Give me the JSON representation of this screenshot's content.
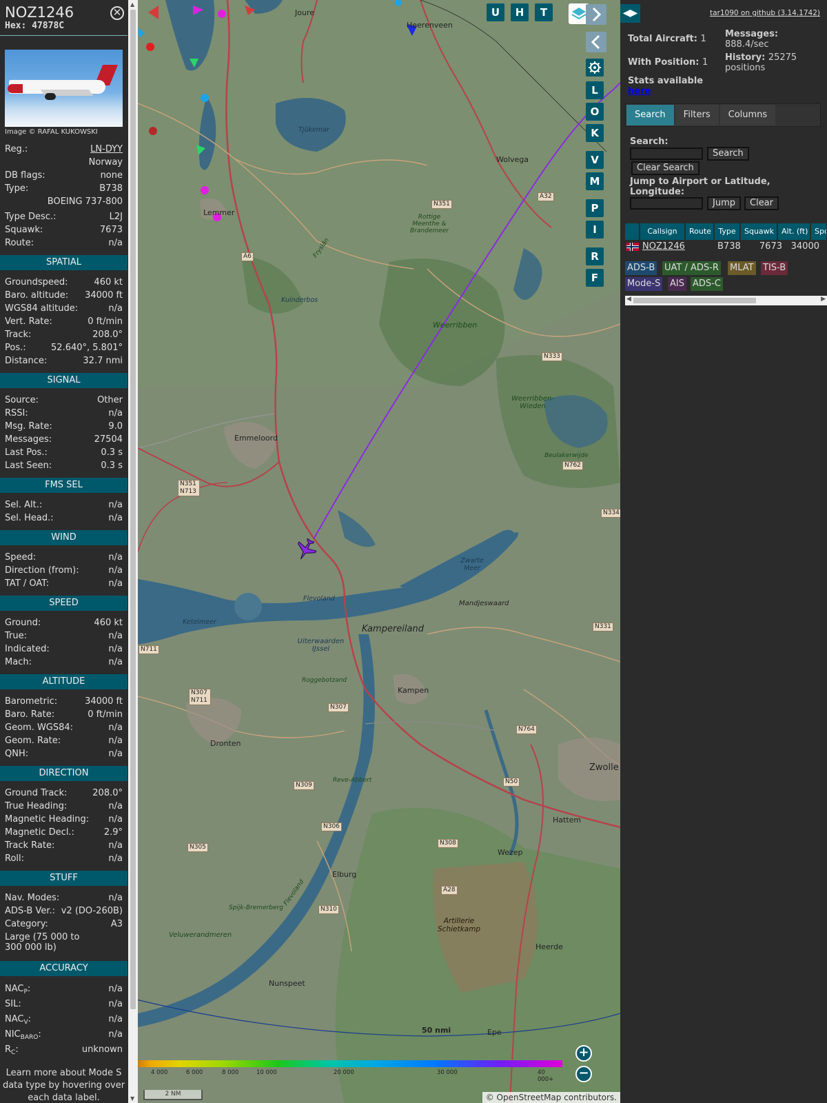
{
  "aircraft": {
    "callsign": "NOZ1246",
    "hex_label": "Hex:",
    "hex": "47878C",
    "image_credit": "Image © RAFAL KUKOWSKI",
    "details": {
      "reg_label": "Reg.:",
      "reg": "LN-DYY",
      "country": "Norway",
      "dbflags_label": "DB flags:",
      "dbflags": "none",
      "type_label": "Type:",
      "type": "B738",
      "type_full": "BOEING 737-800",
      "typedesc_label": "Type Desc.:",
      "typedesc": "L2J",
      "squawk_label": "Squawk:",
      "squawk": "7673",
      "route_label": "Route:",
      "route": "n/a"
    },
    "spatial": {
      "title": "SPATIAL",
      "rows": [
        {
          "label": "Groundspeed:",
          "value": "460 kt"
        },
        {
          "label": "Baro. altitude:",
          "value": "34000 ft"
        },
        {
          "label": "WGS84 altitude:",
          "value": "n/a"
        },
        {
          "label": "Vert. Rate:",
          "value": "0 ft/min"
        },
        {
          "label": "Track:",
          "value": "208.0°"
        },
        {
          "label": "Pos.:",
          "value": "52.640°, 5.801°"
        },
        {
          "label": "Distance:",
          "value": "32.7 nmi"
        }
      ]
    },
    "signal": {
      "title": "SIGNAL",
      "rows": [
        {
          "label": "Source:",
          "value": "Other"
        },
        {
          "label": "RSSI:",
          "value": "n/a"
        },
        {
          "label": "Msg. Rate:",
          "value": "9.0"
        },
        {
          "label": "Messages:",
          "value": "27504"
        },
        {
          "label": "Last Pos.:",
          "value": "0.3 s"
        },
        {
          "label": "Last Seen:",
          "value": "0.3 s"
        }
      ]
    },
    "fms": {
      "title": "FMS SEL",
      "rows": [
        {
          "label": "Sel. Alt.:",
          "value": "n/a"
        },
        {
          "label": "Sel. Head.:",
          "value": "n/a"
        }
      ]
    },
    "wind": {
      "title": "WIND",
      "rows": [
        {
          "label": "Speed:",
          "value": "n/a"
        },
        {
          "label": "Direction (from):",
          "value": "n/a"
        },
        {
          "label": "TAT / OAT:",
          "value": "n/a"
        }
      ]
    },
    "speed": {
      "title": "SPEED",
      "rows": [
        {
          "label": "Ground:",
          "value": "460 kt"
        },
        {
          "label": "True:",
          "value": "n/a"
        },
        {
          "label": "Indicated:",
          "value": "n/a"
        },
        {
          "label": "Mach:",
          "value": "n/a"
        }
      ]
    },
    "altitude": {
      "title": "ALTITUDE",
      "rows": [
        {
          "label": "Barometric:",
          "value": "34000 ft"
        },
        {
          "label": "Baro. Rate:",
          "value": "0 ft/min"
        },
        {
          "label": "Geom. WGS84:",
          "value": "n/a"
        },
        {
          "label": "Geom. Rate:",
          "value": "n/a"
        },
        {
          "label": "QNH:",
          "value": "n/a"
        }
      ]
    },
    "direction": {
      "title": "DIRECTION",
      "rows": [
        {
          "label": "Ground Track:",
          "value": "208.0°"
        },
        {
          "label": "True Heading:",
          "value": "n/a"
        },
        {
          "label": "Magnetic Heading:",
          "value": "n/a"
        },
        {
          "label": "Magnetic Decl.:",
          "value": "2.9°"
        },
        {
          "label": "Track Rate:",
          "value": "n/a"
        },
        {
          "label": "Roll:",
          "value": "n/a"
        }
      ]
    },
    "stuff": {
      "title": "STUFF",
      "rows": [
        {
          "label": "Nav. Modes:",
          "value": "n/a"
        },
        {
          "label": "ADS-B Ver.:",
          "value": "v2 (DO-260B)"
        },
        {
          "label": "Category:",
          "value": "A3"
        }
      ],
      "category_desc": "Large (75 000 to 300 000 lb)"
    },
    "accuracy": {
      "title": "ACCURACY",
      "nacp_main": "NAC",
      "nacp_sub": "P",
      "nacp": "n/a",
      "sil_label": "SIL:",
      "sil": "n/a",
      "nacv_main": "NAC",
      "nacv_sub": "V",
      "nacv": "n/a",
      "nicbaro_main": "NIC",
      "nicbaro_sub": "BARO",
      "nicbaro": "n/a",
      "rc_main": "R",
      "rc_sub": "C",
      "rc": "unknown"
    },
    "footnote": "Learn more about Mode S data type by hovering over each data label."
  },
  "map": {
    "buttons": [
      "U",
      "H",
      "T"
    ],
    "side_buttons": [
      "L",
      "O",
      "K",
      "V",
      "M",
      "P",
      "I",
      "R",
      "F"
    ],
    "places": [
      {
        "name": "Joure"
      },
      {
        "name": "Heerenveen"
      },
      {
        "name": "Wolvega"
      },
      {
        "name": "Lemmer"
      },
      {
        "name": "Emmeloord"
      },
      {
        "name": "Kampereiland"
      },
      {
        "name": "Kampen"
      },
      {
        "name": "Dronten"
      },
      {
        "name": "Zwolle"
      },
      {
        "name": "Hattem"
      },
      {
        "name": "Wezep"
      },
      {
        "name": "Elburg"
      },
      {
        "name": "Nunspeet"
      },
      {
        "name": "Heerde"
      },
      {
        "name": "Epe"
      },
      {
        "name": "Mandjeswaard"
      }
    ],
    "water_labels": [
      "Tjûkemar",
      "Ketelmeer",
      "Zwarte Meer",
      "Flevoland",
      "Kuinderbos",
      "Uiterwaarden IJssel"
    ],
    "green_labels": [
      "Weerribben",
      "Weerribben-Wieden",
      "Rottige Meenthe & Brandemeer",
      "Beulakerwijde",
      "Roggebotzand",
      "Reve-Abbert",
      "Spijk-Bremerberg",
      "Veluwerandmeren",
      "Artillerie Schietkamp",
      "Fryslân",
      "Flevoland"
    ],
    "roads": [
      "N351",
      "A6",
      "N333",
      "A32",
      "N762",
      "N334",
      "N351 N713",
      "N331",
      "N711",
      "N307 N711",
      "N307",
      "N764",
      "N309",
      "N50",
      "N306",
      "N308",
      "N305",
      "A28",
      "N310"
    ],
    "range_label": "50 nmi",
    "color_scale_ticks": [
      "4 000",
      "6 000",
      "8 000",
      "10 000",
      "20 000",
      "30 000",
      "40 000+"
    ],
    "scale_label": "2 NM",
    "attribution": "© OpenStreetMap contributors.",
    "track_color": "#8a2be2"
  },
  "sidebar": {
    "github_link": "tar1090 on github (3.14.1742)",
    "total_aircraft_label": "Total Aircraft:",
    "total_aircraft": "1",
    "with_position_label": "With Position:",
    "with_position": "1",
    "messages_label": "Messages:",
    "messages": "888.4/sec",
    "history_label": "History:",
    "history": "25275 positions",
    "stats_label": "Stats available",
    "stats_link": "here",
    "tabs": [
      "Search",
      "Filters",
      "Columns"
    ],
    "search_label": "Search:",
    "search_button": "Search",
    "clear_search_button": "Clear Search",
    "jump_label": "Jump to Airport or Latitude, Longitude:",
    "jump_button": "Jump",
    "clear_button": "Clear",
    "table_headers": [
      "Callsign",
      "Route",
      "Type",
      "Squawk",
      "Alt. (ft)",
      "Spd"
    ],
    "table_row": {
      "callsign": "NOZ1246",
      "type": "B738",
      "squawk": "7673",
      "alt": "34000"
    },
    "sources": [
      {
        "label": "ADS-B",
        "color": "#1f4a70"
      },
      {
        "label": "UAT / ADS-R",
        "color": "#2d5a2d"
      },
      {
        "label": "MLAT",
        "color": "#6b5a2a"
      },
      {
        "label": "TIS-B",
        "color": "#6a2a3a"
      },
      {
        "label": "Mode-S",
        "color": "#3a3470"
      },
      {
        "label": "AIS",
        "color": "#4a2a50"
      },
      {
        "label": "ADS-C",
        "color": "#2d5a2d"
      }
    ]
  }
}
